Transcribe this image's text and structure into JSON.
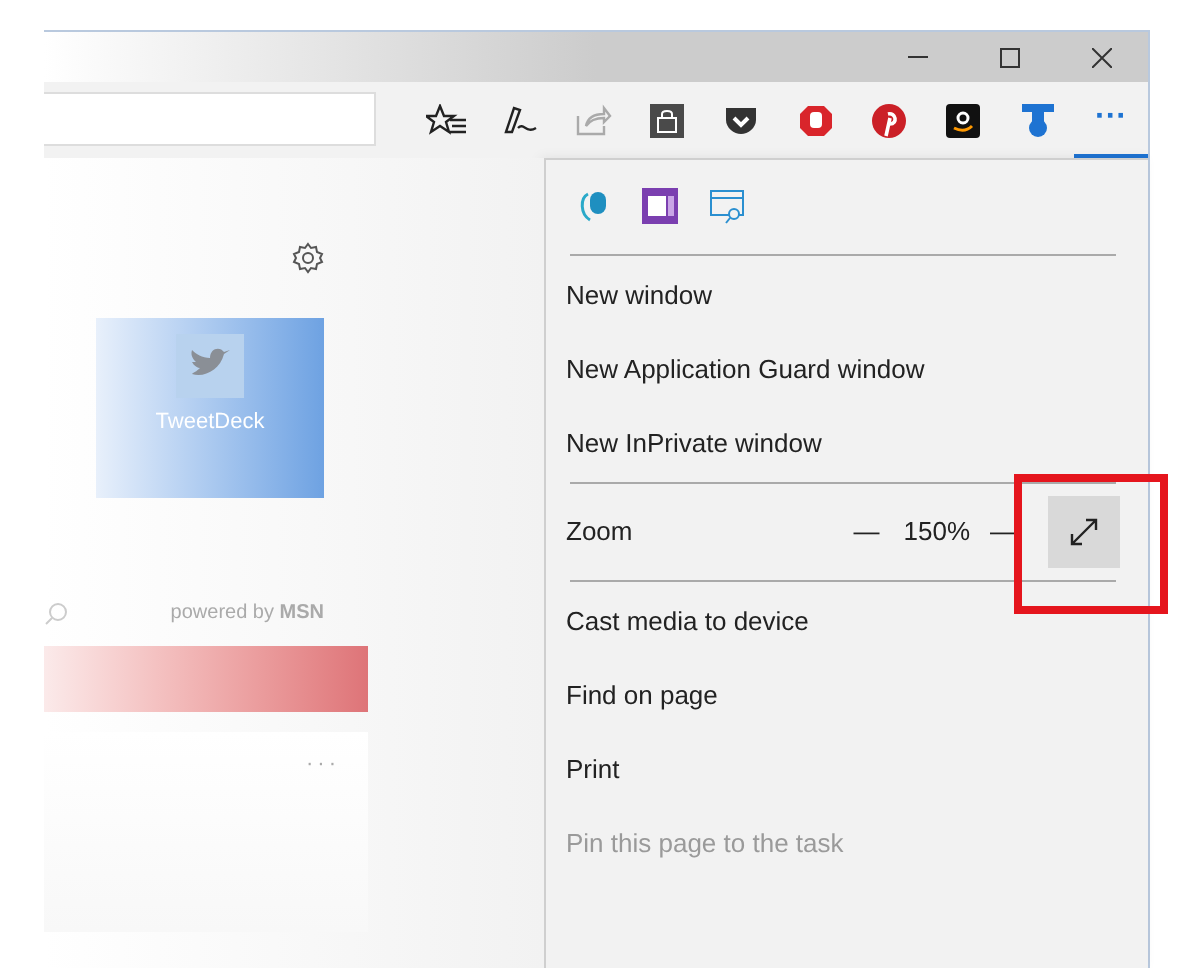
{
  "toolbar": {
    "more_button": {
      "label": "···",
      "selected": true
    }
  },
  "new_tab": {
    "tile": {
      "label": "TweetDeck"
    },
    "news": {
      "attribution": "powered by **MSN**",
      "card_menu": "···"
    }
  },
  "menu": {
    "items": [
      {
        "kind": "icons"
      },
      {
        "kind": "separator"
      },
      {
        "kind": "action",
        "label": "New window",
        "disabled": false
      },
      {
        "kind": "action",
        "label": "New Application Guard window",
        "disabled": false
      },
      {
        "kind": "action",
        "label": "New InPrivate window",
        "disabled": false
      },
      {
        "kind": "separator"
      },
      {
        "kind": "zoom",
        "label": "Zoom",
        "minus": "—",
        "value": "150%",
        "plus": "—"
      },
      {
        "kind": "separator"
      },
      {
        "kind": "action",
        "label": "Cast media to device",
        "disabled": false
      },
      {
        "kind": "action",
        "label": "Find on page",
        "disabled": false
      },
      {
        "kind": "action",
        "label": "Print",
        "disabled": false
      },
      {
        "kind": "action",
        "label": "Pin this page to the task",
        "disabled": true
      }
    ]
  }
}
